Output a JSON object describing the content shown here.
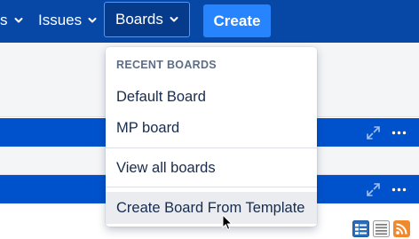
{
  "nav": {
    "partial_label": "s",
    "issues_label": "Issues",
    "boards_label": "Boards",
    "create_label": "Create"
  },
  "boards_menu": {
    "heading": "RECENT BOARDS",
    "recent": [
      "Default Board",
      "MP board"
    ],
    "view_all": "View all boards",
    "create_from_template": "Create Board From Template"
  },
  "icons": {
    "band_actions": [
      "expand-icon",
      "more-icon"
    ],
    "view_switcher": [
      "detail-view-icon",
      "list-view-icon",
      "rss-feed-icon"
    ]
  },
  "colors": {
    "nav_bg": "#0747a6",
    "band_bg": "#0052cc",
    "create_button": "#2684ff",
    "menu_hover": "#ebecf0",
    "rss": "#f0882e"
  }
}
